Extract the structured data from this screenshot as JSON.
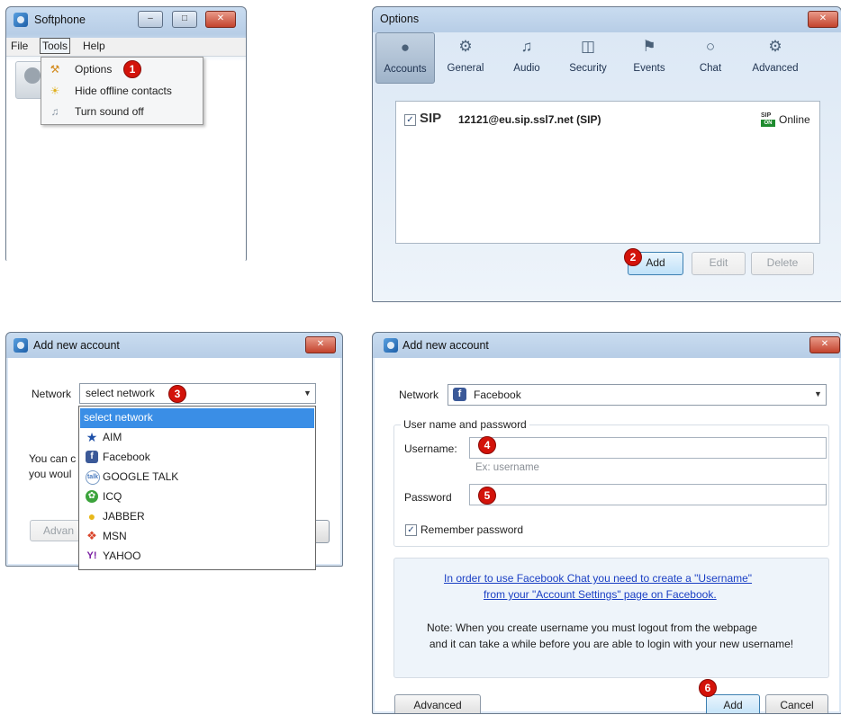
{
  "softphone": {
    "title": "Softphone",
    "menubar": [
      "File",
      "Tools",
      "Help"
    ],
    "menu_items": [
      {
        "label": "Options",
        "icon": "tools-icon"
      },
      {
        "label": "Hide offline contacts",
        "icon": "sun-icon"
      },
      {
        "label": "Turn sound off",
        "icon": "speaker-icon"
      }
    ],
    "step": "1"
  },
  "options": {
    "title": "Options",
    "tabs": [
      "Accounts",
      "General",
      "Audio",
      "Security",
      "Events",
      "Chat",
      "Advanced"
    ],
    "account": {
      "protocol": "SIP",
      "address": "12121@eu.sip.ssl7.net (SIP)",
      "status": "Online",
      "status_badge_top": "SIP",
      "status_badge_bottom": "ON"
    },
    "buttons": {
      "add": "Add",
      "edit": "Edit",
      "delete": "Delete"
    },
    "step": "2"
  },
  "add_account_dropdown": {
    "title": "Add new account",
    "network_label": "Network",
    "selected": "select network",
    "options": [
      "select network",
      "AIM",
      "Facebook",
      "GOOGLE TALK",
      "ICQ",
      "JABBER",
      "MSN",
      "YAHOO"
    ],
    "behind_text_1": "You can c",
    "behind_text_2": "you woul",
    "advanced_partial": "Advan",
    "step": "3"
  },
  "add_account_facebook": {
    "title": "Add new account",
    "network_label": "Network",
    "network_value": "Facebook",
    "group_title": "User name and password",
    "username_label": "Username:",
    "username_value": "",
    "username_hint": "Ex: username",
    "password_label": "Password",
    "password_value": "",
    "remember_label": "Remember password",
    "info_link_1": "In order to use Facebook Chat you need to create a \"Username\"",
    "info_link_2": "from your \"Account Settings\" page on Facebook.",
    "note_1": "Note: When you create username you must logout from the webpage",
    "note_2": "and it can take a while before you are able to login with your new username!",
    "buttons": {
      "advanced": "Advanced",
      "add": "Add",
      "cancel": "Cancel"
    },
    "steps": {
      "username": "4",
      "password": "5",
      "add": "6"
    }
  },
  "colors": {
    "badge": "#d3130a",
    "link": "#1a3fc4",
    "selection": "#3a8ee6"
  }
}
